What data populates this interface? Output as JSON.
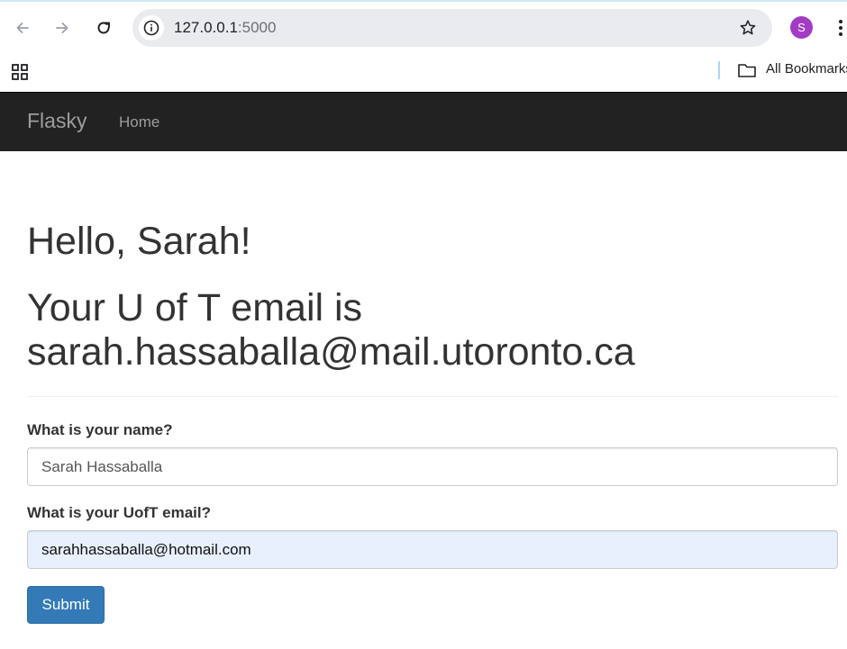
{
  "browser": {
    "url_host": "127.0.0.1",
    "url_port": ":5000",
    "profile_initial": "S",
    "bookmarks_label": "All Bookmarks",
    "icons": [
      "back-arrow-icon",
      "forward-arrow-icon",
      "reload-icon",
      "site-info-icon",
      "bookmark-star-icon",
      "kebab-menu-icon",
      "apps-grid-icon",
      "folder-icon"
    ],
    "accent_color": "#a23cc4"
  },
  "navbar": {
    "brand": "Flasky",
    "links": [
      {
        "label": "Home"
      }
    ],
    "background": "#222222"
  },
  "main": {
    "greeting": "Hello, Sarah!",
    "email_heading": "Your U of T email is sarah.hassaballa@mail.utoronto.ca"
  },
  "form": {
    "name_label": "What is your name?",
    "name_value": "Sarah Hassaballa",
    "email_label": "What is your UofT email?",
    "email_value": "sarahhassaballa@hotmail.com",
    "submit_label": "Submit",
    "submit_color": "#337ab7"
  }
}
